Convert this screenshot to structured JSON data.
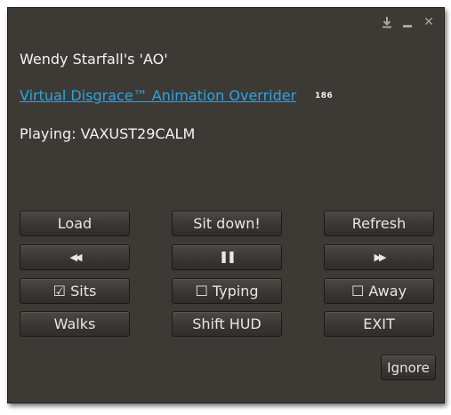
{
  "window": {
    "controls": {
      "dock_icon": "dock-icon",
      "minimize_icon": "minimize-icon",
      "close_icon": "close-icon",
      "close_glyph": "✕"
    }
  },
  "content": {
    "title": "Wendy Starfall's 'AO'",
    "link": "Virtual Disgrace™ Animation Overrider",
    "version": "186",
    "playing": "Playing: VAXUST29CALM"
  },
  "buttons": {
    "load": "Load",
    "sit_down": "Sit down!",
    "refresh": "Refresh",
    "prev": "◀◀",
    "pause": "❚❚",
    "next": "▶▶",
    "sits": "☑ Sits",
    "typing": "☐ Typing",
    "away": "☐ Away",
    "walks": "Walks",
    "shift_hud": "Shift HUD",
    "exit": "EXIT",
    "ignore": "Ignore"
  },
  "colors": {
    "panel_bg": "#3d3a36",
    "link": "#2ea3e0",
    "text": "#f3f3f3"
  }
}
